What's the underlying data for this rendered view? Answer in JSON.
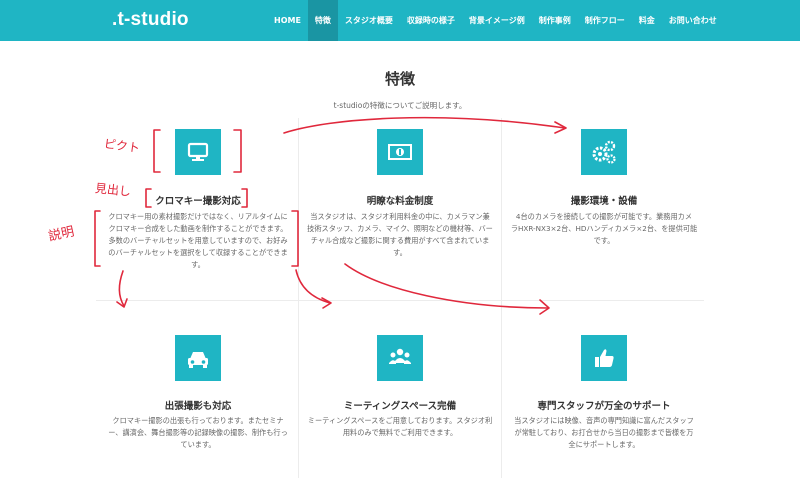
{
  "header": {
    "logo": ".t-studio",
    "nav": [
      "HOME",
      "特徴",
      "スタジオ概要",
      "収録時の様子",
      "背景イメージ例",
      "制作事例",
      "制作フロー",
      "料金",
      "お問い合わせ"
    ],
    "active_index": 1
  },
  "section": {
    "title": "特徴",
    "subtitle": "t-studioの特徴についてご説明します。"
  },
  "features": [
    {
      "icon": "monitor-icon",
      "title": "クロマキー撮影対応",
      "lines": [
        "クロマキー用の素材撮影だけではなく、リアルタイムに",
        "クロマキー合成をした動画を制作することができます。",
        "多数のバーチャルセットを用意していますので、お好み",
        "のバーチャルセットを選択をして収録することができま",
        "す。"
      ]
    },
    {
      "icon": "money-icon",
      "title": "明瞭な料金制度",
      "lines": [
        "当スタジオは、スタジオ利用料金の中に、カメラマン兼",
        "技術スタッフ、カメラ、マイク、照明などの機材等、バー",
        "チャル合成など撮影に関する費用がすべて含まれていま",
        "す。"
      ]
    },
    {
      "icon": "gears-icon",
      "title": "撮影環境・設備",
      "lines": [
        "4台のカメラを接続しての撮影が可能です。業務用カメ",
        "ラHXR-NX3×2台、HDハンディカメラ×2台、を提供可能",
        "です。"
      ]
    },
    {
      "icon": "car-icon",
      "title": "出張撮影も対応",
      "lines": [
        "クロマキー撮影の出張も行っております。またセミナ",
        "ー、講演会、舞台撮影等の記録映像の撮影、制作も行っ",
        "ています。"
      ]
    },
    {
      "icon": "group-icon",
      "title": "ミーティングスペース完備",
      "lines": [
        "ミーティングスペースをご用意しております。スタジオ利",
        "用料のみで無料でご利用できます。"
      ]
    },
    {
      "icon": "thumbs-up-icon",
      "title": "専門スタッフが万全のサポート",
      "lines": [
        "当スタジオには映像、音声の専門知識に富んだスタッフ",
        "が常駐しており、お打合せから当日の撮影まで皆様を万",
        "全にサポートします。"
      ]
    }
  ],
  "annotations": {
    "icon_label": "ピクト",
    "heading_label": "見出し",
    "desc_label": "説明"
  },
  "colors": {
    "brand": "#1fb5c4",
    "nav_active": "#1a95a3",
    "annotation": "#e0283c"
  }
}
